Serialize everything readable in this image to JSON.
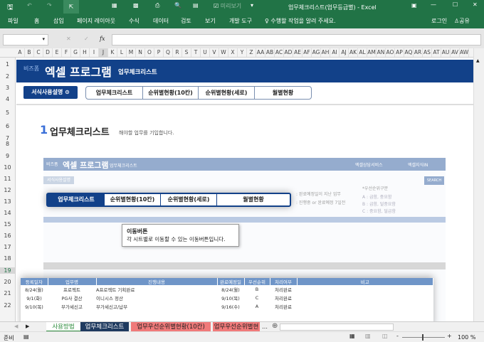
{
  "window": {
    "title": "업무체크리스트(업무등급별) - Excel",
    "qat_checkbox": "미리보기"
  },
  "ribbon": {
    "tabs": [
      "파일",
      "홈",
      "삽입",
      "페이지 레이아웃",
      "수식",
      "데이터",
      "검토",
      "보기",
      "개발 도구"
    ],
    "tell_me": "수행할 작업을 알려 주세요.",
    "login": "로그인",
    "share": "공유"
  },
  "formula": {
    "fx": "fx",
    "cancel": "✕",
    "enter": "✓"
  },
  "columns": [
    "A",
    "B",
    "C",
    "D",
    "E",
    "F",
    "G",
    "H",
    "I",
    "J",
    "K",
    "L",
    "M",
    "N",
    "O",
    "P",
    "Q",
    "R",
    "S",
    "T",
    "U",
    "V",
    "W",
    "X",
    "Y",
    "Z",
    "AA",
    "AB",
    "AC",
    "AD",
    "AE",
    "AF",
    "AG",
    "AH",
    "AI",
    "AJ",
    "AK",
    "AL",
    "AM",
    "AN",
    "AO",
    "AP",
    "AQ",
    "AR",
    "AS",
    "AT",
    "AU",
    "AV",
    "AW"
  ],
  "rows": [
    "1",
    "2",
    "3",
    "4",
    "5",
    "6",
    "7",
    "8",
    "9",
    "10",
    "11",
    "12",
    "13",
    "14",
    "15",
    "16",
    "17",
    "18",
    "19",
    "20",
    "21",
    "22"
  ],
  "banner": {
    "brand": "비즈폼",
    "title": "엑셀 프로그램",
    "subtitle": "업무체크리스트"
  },
  "nav": {
    "help": "서식사용설명",
    "buttons": [
      "업무체크리스트",
      "순위별현황(10칸)",
      "순위별현황(세로)",
      "월별현황"
    ]
  },
  "section": {
    "number": "1",
    "title": "업무체크리스트",
    "desc": "해야할 업무를 기입합니다."
  },
  "preview": {
    "brand": "비즈폼",
    "title": "엑셀 프로그램",
    "subtitle": "업무체크리스트",
    "phone": "엑셀상담서비스",
    "knowledge": "엑셀지식IN",
    "search_btn": "SEARCH",
    "legend1": ": 완료예정일이 지난 업무",
    "legend2": ": 진행중 or 완료예정 7일전",
    "priority_title": "*우선순위구분",
    "priority": [
      "A : 급함, 중요함",
      "B : 급함, 덜중요함",
      "C : 중요함, 덜급함"
    ]
  },
  "tooltip": {
    "title": "이동버튼",
    "body": "각 시트별로 이동할 수 있는 이동버튼입니다."
  },
  "table": {
    "headers": [
      "등록일자",
      "업무명",
      "진행내용",
      "완료예정일",
      "우선순위",
      "처리여부",
      "비고"
    ],
    "rows": [
      [
        "8/24(월)",
        "프로젝트",
        "A프로젝트 기획완료",
        "8/24(월)",
        "B",
        "처리완료",
        ""
      ],
      [
        "9/1(화)",
        "PG사 결산",
        "이니시스 정산",
        "9/10(목)",
        "C",
        "처리완료",
        ""
      ],
      [
        "9/10(목)",
        "부가세신고",
        "부가세신고/납부",
        "9/16(수)",
        "A",
        "처리완료",
        ""
      ]
    ]
  },
  "sheet_tabs": [
    "사용방법",
    "업무체크리스트",
    "업무우선순위별현황(10칸)",
    "업무우선순위별현"
  ],
  "status": {
    "ready": "준비",
    "zoom": "100 %"
  }
}
